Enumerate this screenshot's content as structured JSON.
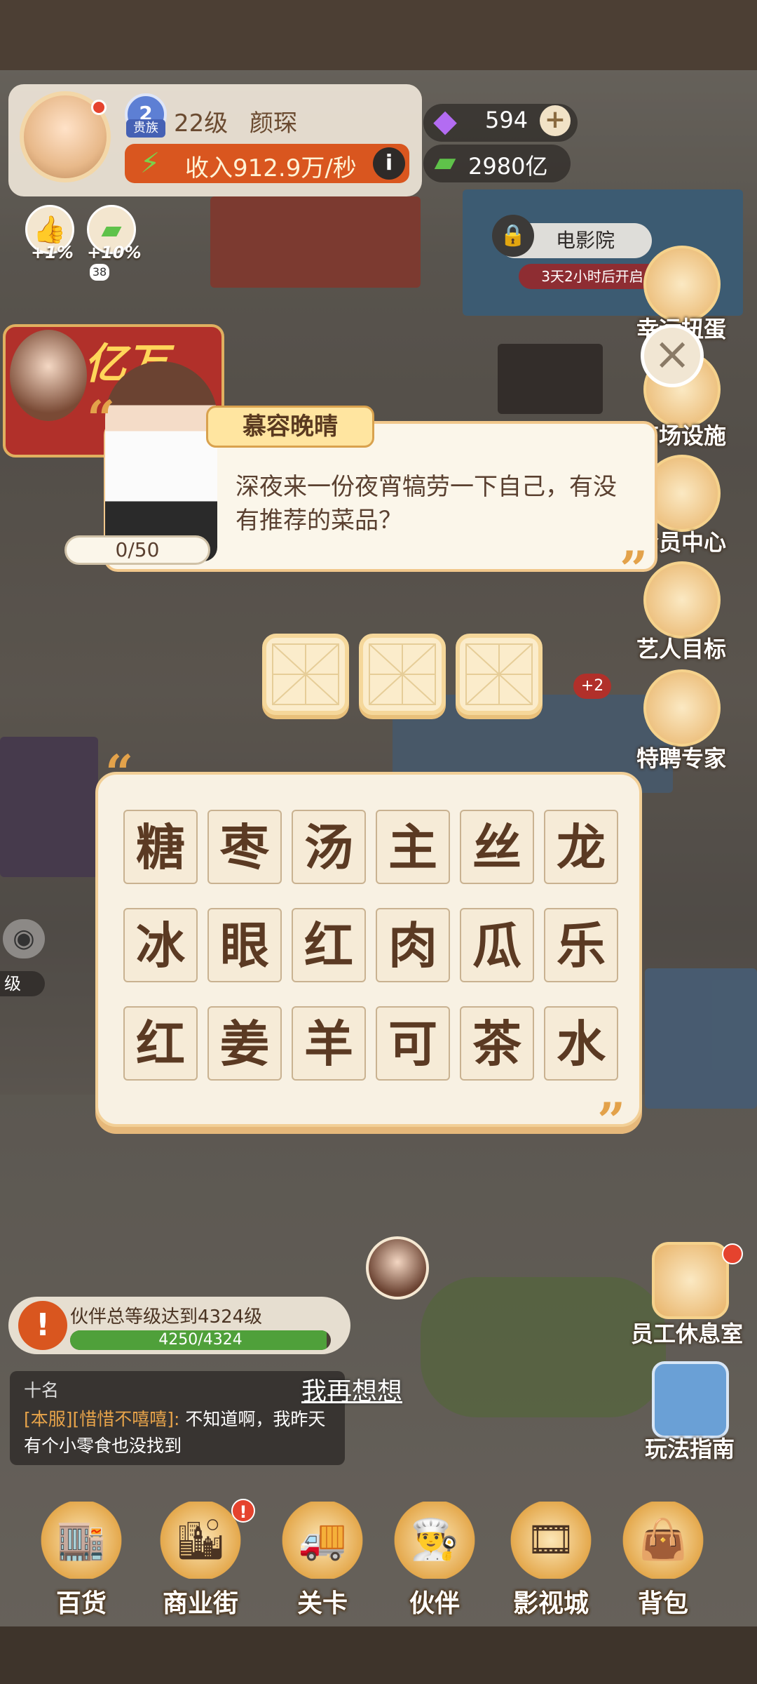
{
  "header": {
    "rank_number": "2",
    "rank_label": "贵族",
    "level": "22级",
    "player_name": "颜琛",
    "income": "收入912.9万/秒",
    "info_label": "i",
    "gems": "594",
    "cash": "2980亿"
  },
  "buffs": [
    {
      "pct": "+1%",
      "icon": "thumbs-up-icon"
    },
    {
      "pct": "+10%",
      "icon": "cash-icon"
    }
  ],
  "buff_count": "38",
  "cinema": {
    "title": "电影院",
    "note": "3天2小时后开启"
  },
  "promo_text": "亿万",
  "side_menu": [
    {
      "label": "幸运扭蛋"
    },
    {
      "label": "商场设施"
    },
    {
      "label": "会员中心"
    },
    {
      "label": "艺人目标"
    },
    {
      "label": "特聘专家"
    }
  ],
  "side_badge": "+2",
  "dialog": {
    "name": "慕容晚晴",
    "question": "深夜来一份夜宵犒劳一下自己，有没有推荐的菜品？",
    "progress": "0/50",
    "open_quote": "“",
    "close_quote": "”"
  },
  "answer_slots": [
    "",
    "",
    ""
  ],
  "letters": [
    [
      "糖",
      "枣",
      "汤",
      "主",
      "丝",
      "龙"
    ],
    [
      "冰",
      "眼",
      "红",
      "肉",
      "瓜",
      "乐"
    ],
    [
      "红",
      "姜",
      "羊",
      "可",
      "茶",
      "水"
    ]
  ],
  "quest": {
    "text": "伙伴总等级达到4324级",
    "progress_text": "4250/4324",
    "progress": 0.983
  },
  "chat": {
    "title": "十名",
    "channel": "[本服]",
    "user": "[惜惜不嘻嘻]",
    "message": "不知道啊，我昨天有个小零食也没找到"
  },
  "think_again": "我再想想",
  "right_bottom": [
    {
      "label": "员工休息室"
    },
    {
      "label": "玩法指南"
    }
  ],
  "bottom_nav": [
    {
      "label": "百货",
      "icon": "department-store-icon"
    },
    {
      "label": "商业街",
      "icon": "commercial-street-icon"
    },
    {
      "label": "关卡",
      "icon": "truck-icon"
    },
    {
      "label": "伙伴",
      "icon": "chef-icon"
    },
    {
      "label": "影视城",
      "icon": "film-reel-icon"
    },
    {
      "label": "背包",
      "icon": "bag-icon"
    }
  ],
  "left_level_label": "级",
  "colors": {
    "accent": "#d9561f",
    "panel": "#f8f1e3",
    "tile_text": "#5b3a23",
    "progress_green": "#4fa03a"
  }
}
